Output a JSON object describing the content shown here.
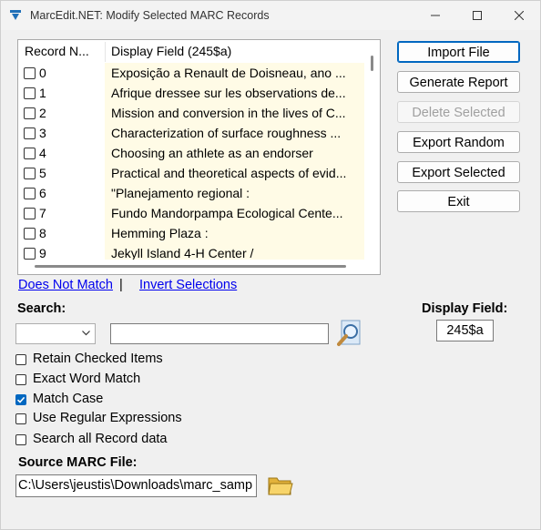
{
  "window": {
    "title": "MarcEdit.NET: Modify Selected MARC Records"
  },
  "list": {
    "columns": [
      "Record N...",
      "Display Field (245$a)"
    ],
    "rows": [
      {
        "id": "0",
        "text": "Exposição a Renault de Doisneau, ano ..."
      },
      {
        "id": "1",
        "text": "Afrique dressee sur les observations de..."
      },
      {
        "id": "2",
        "text": "Mission and conversion in the lives of C..."
      },
      {
        "id": "3",
        "text": "Characterization of surface roughness ..."
      },
      {
        "id": "4",
        "text": "Choosing an athlete as an endorser"
      },
      {
        "id": "5",
        "text": "Practical and theoretical aspects of evid..."
      },
      {
        "id": "6",
        "text": "\"Planejamento regional :"
      },
      {
        "id": "7",
        "text": "Fundo Mandorpampa Ecological Cente..."
      },
      {
        "id": "8",
        "text": "Hemming Plaza :"
      },
      {
        "id": "9",
        "text": "Jekyll Island 4-H Center /"
      }
    ]
  },
  "buttons": {
    "import": "Import File",
    "report": "Generate Report",
    "delete": "Delete Selected",
    "export_random": "Export Random",
    "export_selected": "Export Selected",
    "exit": "Exit"
  },
  "links": {
    "not_match": "Does Not Match",
    "separator": "|",
    "invert": "Invert Selections"
  },
  "search": {
    "label": "Search:",
    "field_value": "",
    "combo_value": ""
  },
  "display_field": {
    "label": "Display Field:",
    "value": "245$a"
  },
  "options": [
    {
      "label": "Retain Checked Items",
      "checked": false
    },
    {
      "label": "Exact Word Match",
      "checked": false
    },
    {
      "label": "Match Case",
      "checked": true
    },
    {
      "label": "Use Regular Expressions",
      "checked": false
    },
    {
      "label": "Search all Record data",
      "checked": false
    }
  ],
  "source": {
    "label": "Source MARC File:",
    "path": "C:\\Users\\jeustis\\Downloads\\marc_samp"
  },
  "colors": {
    "accent": "#0067c0",
    "row_highlight": "#fffbe6",
    "link": "#0000ee"
  }
}
